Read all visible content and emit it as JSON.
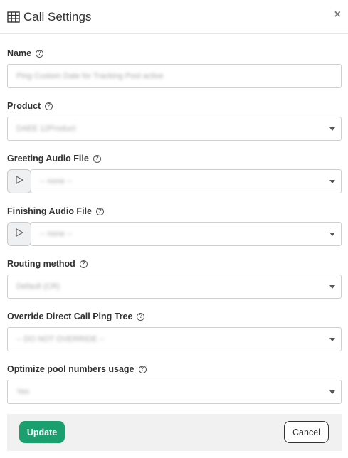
{
  "dialog": {
    "title": "Call Settings",
    "title_icon": "table-grid-icon",
    "close_icon": "close-icon",
    "close_glyph": "×"
  },
  "fields": {
    "name": {
      "label": "Name",
      "value": "Ping Custom Date for Tracking Pool active"
    },
    "product": {
      "label": "Product",
      "value": "DAEE 12Product"
    },
    "greeting": {
      "label": "Greeting Audio File",
      "value": "-- none --"
    },
    "finishing": {
      "label": "Finishing Audio File",
      "value": "-- none --"
    },
    "routing": {
      "label": "Routing method",
      "value": "Default (CR)"
    },
    "override": {
      "label": "Override Direct Call Ping Tree",
      "value": "-- DO NOT OVERRIDE --"
    },
    "optimize": {
      "label": "Optimize pool numbers usage",
      "value": "Yes"
    }
  },
  "help_glyph": "?",
  "footer": {
    "update_label": "Update",
    "cancel_label": "Cancel"
  },
  "colors": {
    "primary": "#1a9f6e",
    "border": "#d0d0d0",
    "footer_bg": "#f1f1f1"
  }
}
